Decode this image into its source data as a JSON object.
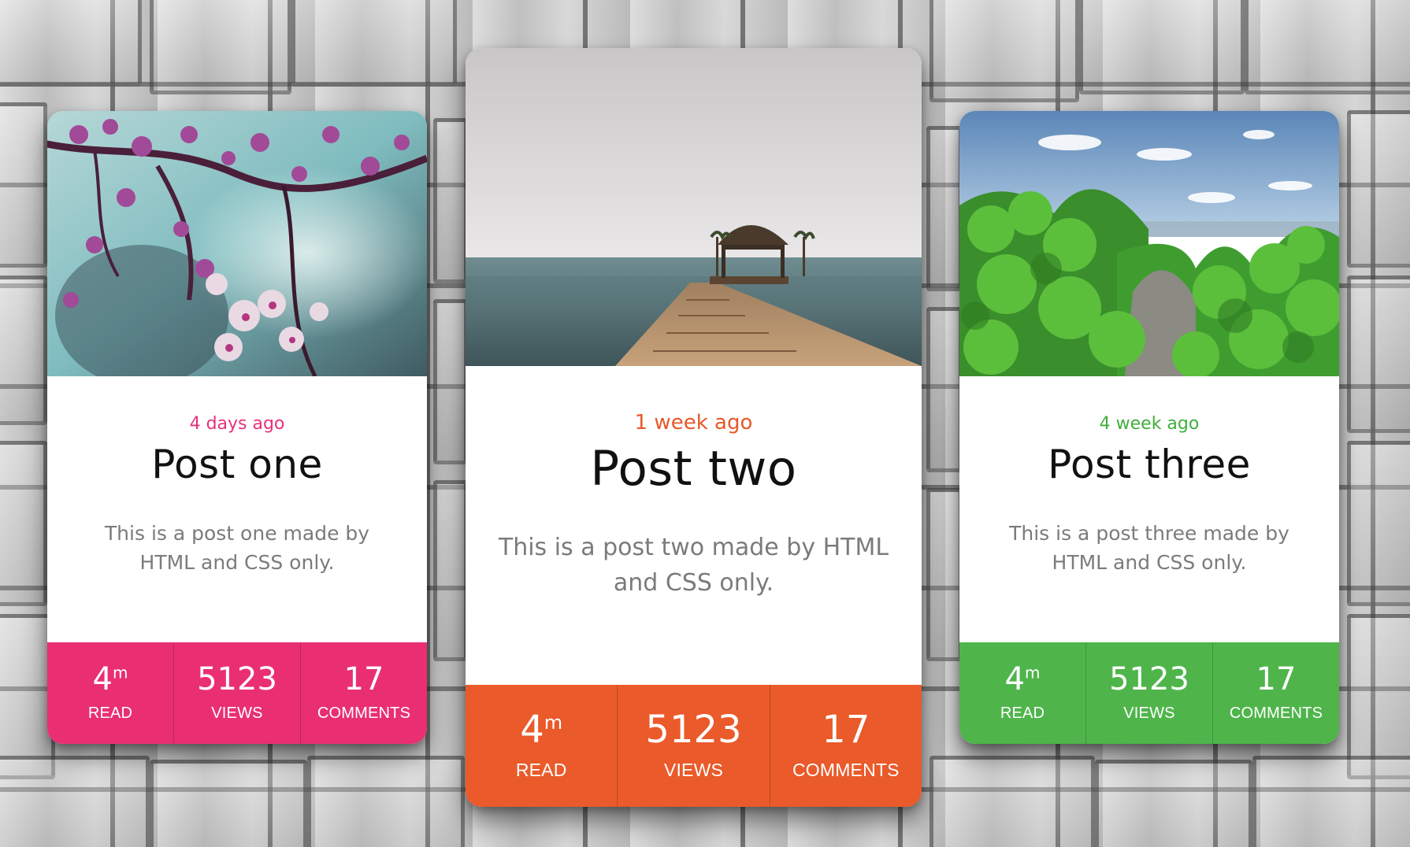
{
  "colors": {
    "card_one_accent": "#e92f72",
    "card_two_accent": "#ea5a2a",
    "card_three_accent": "#4fb54b"
  },
  "cards": [
    {
      "id": "one",
      "image_icon": "cherry-blossom-image",
      "date": "4 days ago",
      "title": "Post one",
      "description": "This is a post one made by HTML and CSS only.",
      "stats": [
        {
          "value": "4",
          "sup": "m",
          "label": "READ"
        },
        {
          "value": "5123",
          "sup": "",
          "label": "VIEWS"
        },
        {
          "value": "17",
          "sup": "",
          "label": "COMMENTS"
        }
      ]
    },
    {
      "id": "two",
      "image_icon": "pier-ocean-image",
      "date": "1 week ago",
      "title": "Post two",
      "description": "This is a post two made by HTML and CSS only.",
      "stats": [
        {
          "value": "4",
          "sup": "m",
          "label": "READ"
        },
        {
          "value": "5123",
          "sup": "",
          "label": "VIEWS"
        },
        {
          "value": "17",
          "sup": "",
          "label": "COMMENTS"
        }
      ]
    },
    {
      "id": "three",
      "image_icon": "green-forest-image",
      "date": "4 week ago",
      "title": "Post three",
      "description": "This is a post three made by HTML and CSS only.",
      "stats": [
        {
          "value": "4",
          "sup": "m",
          "label": "READ"
        },
        {
          "value": "5123",
          "sup": "",
          "label": "VIEWS"
        },
        {
          "value": "17",
          "sup": "",
          "label": "COMMENTS"
        }
      ]
    }
  ]
}
